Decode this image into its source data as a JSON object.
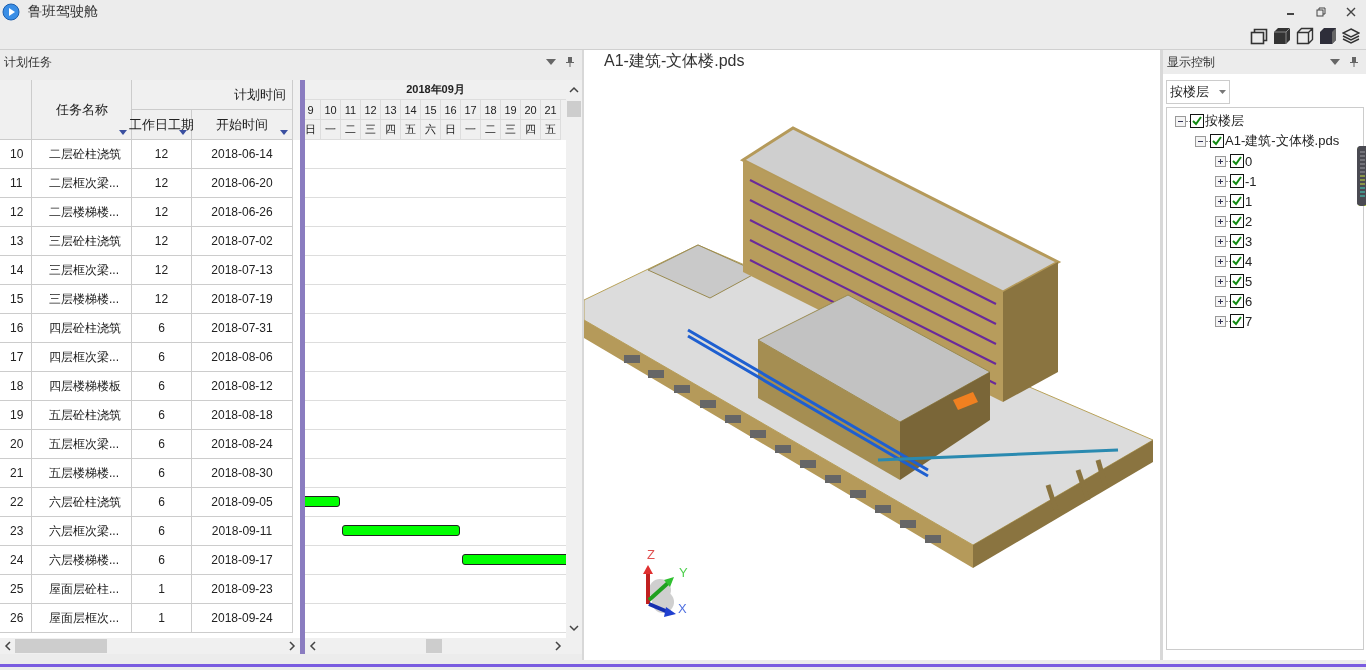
{
  "app": {
    "title": "鲁班驾驶舱"
  },
  "plan_panel": {
    "title": "计划任务",
    "columns": {
      "name": "任务名称",
      "group": "计划时间",
      "workdays": "工作日工期",
      "start": "开始时间"
    },
    "timeline": {
      "month": "2018年09月",
      "days": [
        {
          "day": "9",
          "weekday": "日"
        },
        {
          "day": "10",
          "weekday": "一"
        },
        {
          "day": "11",
          "weekday": "二"
        },
        {
          "day": "12",
          "weekday": "三"
        },
        {
          "day": "13",
          "weekday": "四"
        },
        {
          "day": "14",
          "weekday": "五"
        },
        {
          "day": "15",
          "weekday": "六"
        },
        {
          "day": "16",
          "weekday": "日"
        },
        {
          "day": "17",
          "weekday": "一"
        },
        {
          "day": "18",
          "weekday": "二"
        },
        {
          "day": "19",
          "weekday": "三"
        },
        {
          "day": "20",
          "weekday": "四"
        },
        {
          "day": "21",
          "weekday": "五"
        }
      ]
    },
    "rows": [
      {
        "no": "10",
        "name": "二层砼柱浇筑",
        "workdays": "12",
        "start": "2018-06-14"
      },
      {
        "no": "11",
        "name": "二层框次梁...",
        "workdays": "12",
        "start": "2018-06-20"
      },
      {
        "no": "12",
        "name": "二层楼梯楼...",
        "workdays": "12",
        "start": "2018-06-26"
      },
      {
        "no": "13",
        "name": "三层砼柱浇筑",
        "workdays": "12",
        "start": "2018-07-02"
      },
      {
        "no": "14",
        "name": "三层框次梁...",
        "workdays": "12",
        "start": "2018-07-13"
      },
      {
        "no": "15",
        "name": "三层楼梯楼...",
        "workdays": "12",
        "start": "2018-07-19"
      },
      {
        "no": "16",
        "name": "四层砼柱浇筑",
        "workdays": "6",
        "start": "2018-07-31"
      },
      {
        "no": "17",
        "name": "四层框次梁...",
        "workdays": "6",
        "start": "2018-08-06"
      },
      {
        "no": "18",
        "name": "四层楼梯楼板",
        "workdays": "6",
        "start": "2018-08-12"
      },
      {
        "no": "19",
        "name": "五层砼柱浇筑",
        "workdays": "6",
        "start": "2018-08-18"
      },
      {
        "no": "20",
        "name": "五层框次梁...",
        "workdays": "6",
        "start": "2018-08-24"
      },
      {
        "no": "21",
        "name": "五层楼梯楼...",
        "workdays": "6",
        "start": "2018-08-30"
      },
      {
        "no": "22",
        "name": "六层砼柱浇筑",
        "workdays": "6",
        "start": "2018-09-05"
      },
      {
        "no": "23",
        "name": "六层框次梁...",
        "workdays": "6",
        "start": "2018-09-11"
      },
      {
        "no": "24",
        "name": "六层楼梯楼...",
        "workdays": "6",
        "start": "2018-09-17"
      },
      {
        "no": "25",
        "name": "屋面层砼柱...",
        "workdays": "1",
        "start": "2018-09-23"
      },
      {
        "no": "26",
        "name": "屋面层框次...",
        "workdays": "1",
        "start": "2018-09-24"
      }
    ]
  },
  "viewer": {
    "title": "A1-建筑-文体楼.pds",
    "axes": {
      "z": "Z",
      "y": "Y",
      "x": "X"
    }
  },
  "display_panel": {
    "title": "显示控制",
    "mode": {
      "value": "按楼层"
    },
    "tree": [
      {
        "label": "按楼层",
        "checked": true,
        "expanded": true,
        "children": [
          {
            "label": "A1-建筑-文体楼.pds",
            "checked": true,
            "expanded": true,
            "children": [
              {
                "label": "0",
                "checked": true,
                "expanded": false
              },
              {
                "label": "-1",
                "checked": true,
                "expanded": false
              },
              {
                "label": "1",
                "checked": true,
                "expanded": false
              },
              {
                "label": "2",
                "checked": true,
                "expanded": false
              },
              {
                "label": "3",
                "checked": true,
                "expanded": false
              },
              {
                "label": "4",
                "checked": true,
                "expanded": false
              },
              {
                "label": "5",
                "checked": true,
                "expanded": false
              },
              {
                "label": "6",
                "checked": true,
                "expanded": false
              },
              {
                "label": "7",
                "checked": true,
                "expanded": false
              }
            ]
          }
        ]
      }
    ]
  }
}
